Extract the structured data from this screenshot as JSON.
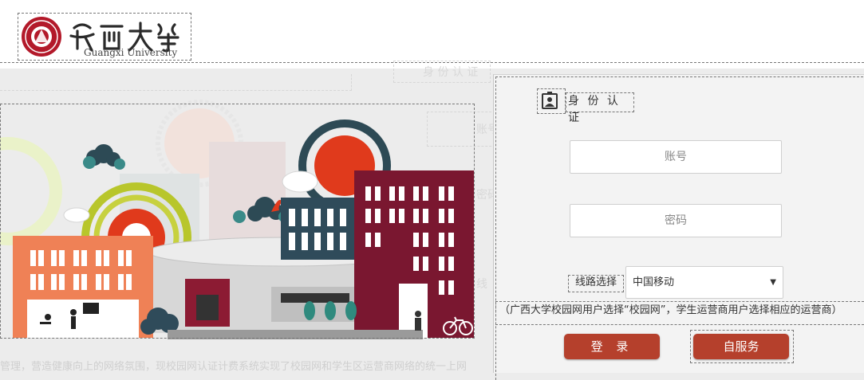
{
  "header": {
    "university_name": "广西大学",
    "university_name_en": "Guangxi University"
  },
  "background_ghost": {
    "tab_label": "身 份 认 证",
    "fragments": [
      "账号",
      "密码",
      "线",
      "选择",
      "登"
    ],
    "bottom_text": "管理，营造健康向上的网络氛围，现校园网认证计费系统实现了校园网和学生区运营商网络的统一上网"
  },
  "login": {
    "auth_title": "身 份 认 证",
    "account_placeholder": "账号",
    "password_placeholder": "密码",
    "route_label": "线路选择",
    "route_selected": "中国移动",
    "route_arrow": "▼",
    "note": "（广西大学校园网用户选择“校园网”，学生运营商用户选择相应的运营商）",
    "login_button": "登 录",
    "self_service_button": "自服务"
  },
  "colors": {
    "brand_red": "#b5402c",
    "building_maroon": "#7a1730",
    "building_orange": "#ef8156",
    "sun_red": "#e03a1c"
  },
  "icons": [
    "id-card-icon",
    "dropdown-arrow-icon",
    "university-seal-icon",
    "bicycle-icon"
  ]
}
